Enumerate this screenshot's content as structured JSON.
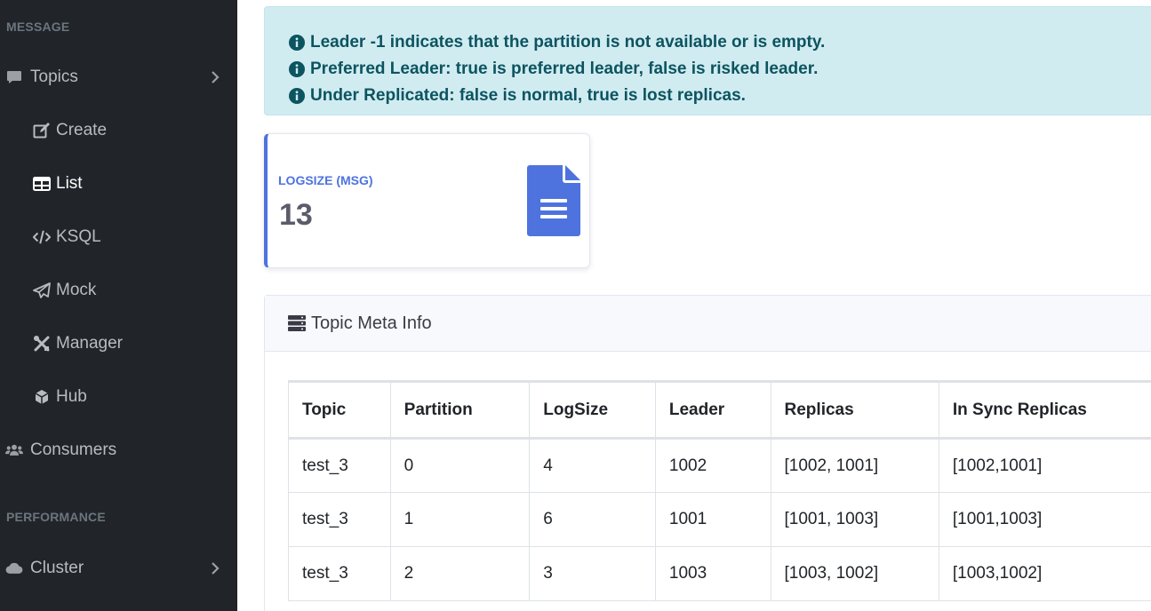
{
  "sidebar": {
    "heading_message": "MESSAGE",
    "heading_performance": "PERFORMANCE",
    "items": [
      {
        "label": "Topics",
        "icon": "comment-icon"
      },
      {
        "label": "Create",
        "icon": "edit-icon"
      },
      {
        "label": "List",
        "icon": "table-icon"
      },
      {
        "label": "KSQL",
        "icon": "code-icon"
      },
      {
        "label": "Mock",
        "icon": "paper-plane-icon"
      },
      {
        "label": "Manager",
        "icon": "tools-icon"
      },
      {
        "label": "Hub",
        "icon": "cube-icon"
      },
      {
        "label": "Consumers",
        "icon": "users-icon"
      },
      {
        "label": "Cluster",
        "icon": "cloud-icon"
      }
    ],
    "colors": {
      "background": "#212529",
      "text": "#b8bcc0",
      "active": "#ffffff",
      "heading": "#6c757d"
    }
  },
  "alert": {
    "lines": [
      "Leader -1 indicates that the partition is not available or is empty.",
      "Preferred Leader: true is preferred leader, false is risked leader.",
      "Under Replicated: false is normal, true is lost replicas."
    ],
    "colors": {
      "background": "#d1ecf1",
      "text": "#0c5460"
    }
  },
  "stat_card": {
    "label": "LOGSIZE (MSG)",
    "value": "13",
    "icon": "file-alt-icon",
    "accent": "#4e73df"
  },
  "meta_panel": {
    "title": "Topic Meta Info",
    "icon": "server-icon",
    "columns": [
      "Topic",
      "Partition",
      "LogSize",
      "Leader",
      "Replicas",
      "In Sync Replicas"
    ],
    "rows": [
      [
        "test_3",
        "0",
        "4",
        "1002",
        "[1002, 1001]",
        "[1002,1001]"
      ],
      [
        "test_3",
        "1",
        "6",
        "1001",
        "[1001, 1003]",
        "[1001,1003]"
      ],
      [
        "test_3",
        "2",
        "3",
        "1003",
        "[1003, 1002]",
        "[1003,1002]"
      ]
    ]
  }
}
